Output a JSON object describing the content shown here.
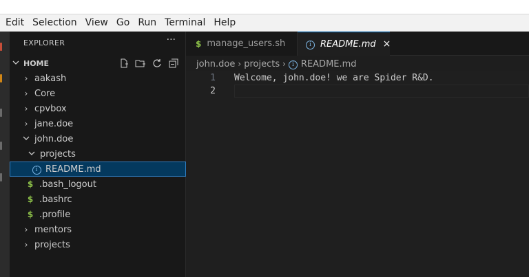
{
  "menu": [
    "Edit",
    "Selection",
    "View",
    "Go",
    "Run",
    "Terminal",
    "Help"
  ],
  "sidebar": {
    "title": "EXPLORER",
    "more": "···",
    "root": "HOME",
    "items": [
      {
        "label": "aakash",
        "kind": "folder",
        "expanded": false
      },
      {
        "label": "Core",
        "kind": "folder",
        "expanded": false
      },
      {
        "label": "cpvbox",
        "kind": "folder",
        "expanded": false
      },
      {
        "label": "jane.doe",
        "kind": "folder",
        "expanded": false
      },
      {
        "label": "john.doe",
        "kind": "folder",
        "expanded": true
      },
      {
        "label": "projects",
        "kind": "folder",
        "expanded": true
      },
      {
        "label": "README.md",
        "kind": "markdown",
        "selected": true
      },
      {
        "label": ".bash_logout",
        "kind": "shell"
      },
      {
        "label": ".bashrc",
        "kind": "shell"
      },
      {
        "label": ".profile",
        "kind": "shell"
      },
      {
        "label": "mentors",
        "kind": "folder",
        "expanded": false
      },
      {
        "label": "projects",
        "kind": "folder",
        "expanded": false
      }
    ]
  },
  "tabs": [
    {
      "label": "manage_users.sh",
      "active": false
    },
    {
      "label": "README.md",
      "active": true
    }
  ],
  "icons": {
    "shell": "$",
    "info": "i",
    "close": "×",
    "chevron_right": "›",
    "chevron_down": "⌄"
  },
  "breadcrumb": [
    "john.doe",
    "projects",
    "README.md"
  ],
  "editor": {
    "lines": [
      {
        "number": "1",
        "text": "Welcome, john.doe! we are Spider R&D."
      },
      {
        "number": "2",
        "text": ""
      }
    ]
  },
  "colors": {
    "accent": "#0078d4",
    "shell_icon": "#8dc149",
    "info_icon": "#7fb8e6",
    "selection": "#04395e"
  }
}
